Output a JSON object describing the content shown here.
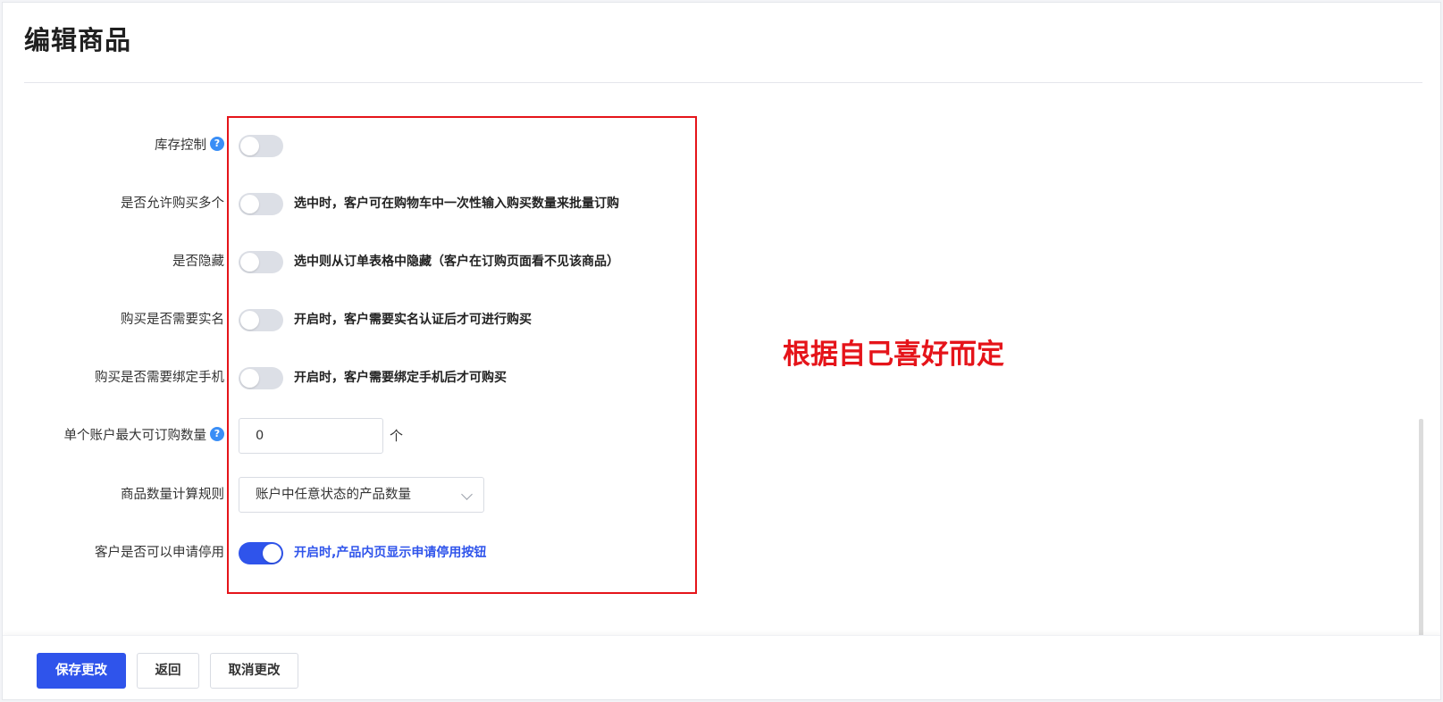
{
  "page": {
    "title": "编辑商品"
  },
  "form": {
    "stock_control": {
      "label": "库存控制",
      "help": "?",
      "enabled": false
    },
    "allow_multiple": {
      "label": "是否允许购买多个",
      "enabled": false,
      "description": "选中时，客户可在购物车中一次性输入购买数量来批量订购"
    },
    "hidden": {
      "label": "是否隐藏",
      "enabled": false,
      "description": "选中则从订单表格中隐藏（客户在订购页面看不见该商品）"
    },
    "require_realname": {
      "label": "购买是否需要实名",
      "enabled": false,
      "description": "开启时，客户需要实名认证后才可进行购买"
    },
    "require_phone": {
      "label": "购买是否需要绑定手机",
      "enabled": false,
      "description": "开启时，客户需要绑定手机后才可购买"
    },
    "max_per_account": {
      "label": "单个账户最大可订购数量",
      "help": "?",
      "value": "0",
      "unit": "个"
    },
    "count_rule": {
      "label": "商品数量计算规则",
      "selected": "账户中任意状态的产品数量",
      "icon": "chevron-down-icon"
    },
    "allow_suspend": {
      "label": "客户是否可以申请停用",
      "enabled": true,
      "description": "开启时,产品内页显示申请停用按钮"
    }
  },
  "annotation": {
    "text": "根据自己喜好而定",
    "color": "#e5141a"
  },
  "footer": {
    "save_label": "保存更改",
    "back_label": "返回",
    "cancel_label": "取消更改"
  },
  "colors": {
    "accent": "#2f54eb",
    "help_icon": "#3a8ef6",
    "toggle_off": "#dcdfe6",
    "annotation_red": "#e5141a"
  }
}
